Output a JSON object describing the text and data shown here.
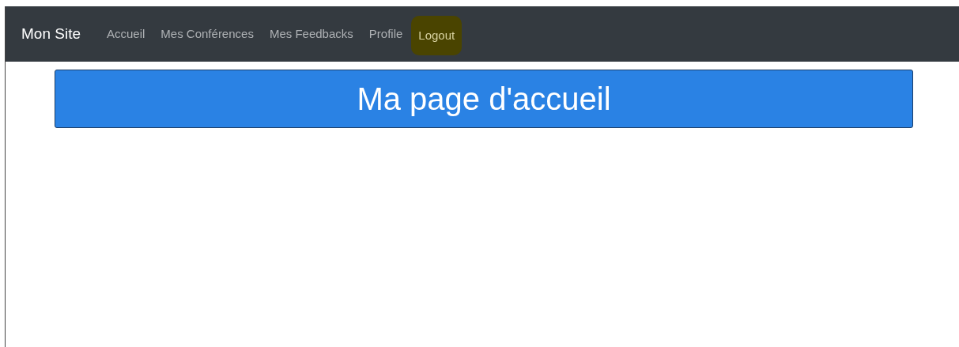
{
  "navbar": {
    "brand": "Mon Site",
    "items": [
      {
        "label": "Accueil",
        "highlighted": false
      },
      {
        "label": "Mes Conférences",
        "highlighted": false
      },
      {
        "label": "Mes Feedbacks",
        "highlighted": false
      },
      {
        "label": "Profile",
        "highlighted": false
      },
      {
        "label": "Logout",
        "highlighted": true
      }
    ]
  },
  "banner": {
    "title": "Ma page d'accueil"
  }
}
